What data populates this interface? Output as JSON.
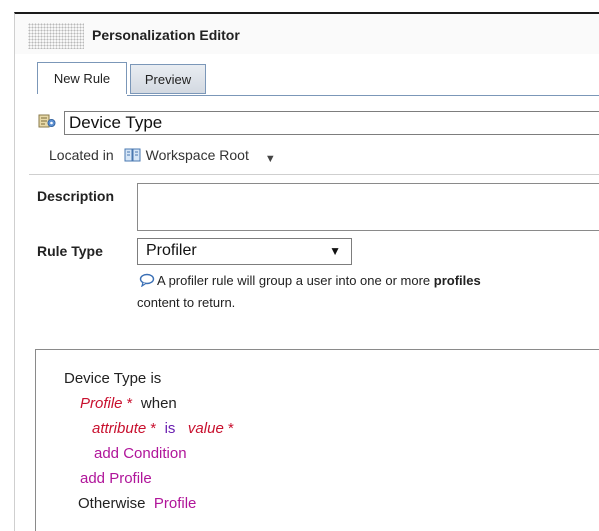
{
  "editor": {
    "title": "Personalization Editor"
  },
  "tabs": [
    {
      "label": "New Rule",
      "active": true
    },
    {
      "label": "Preview",
      "active": false
    }
  ],
  "rule": {
    "name": "Device Type",
    "located_in_label": "Located in",
    "location": "Workspace Root"
  },
  "form": {
    "description_label": "Description",
    "description_value": "",
    "rule_type_label": "Rule Type",
    "rule_type_value": "Profiler",
    "hint_prefix": "A profiler rule will group a user into one or more ",
    "hint_bold": "profiles",
    "hint_line2": "content to return."
  },
  "rule_body": {
    "subject": "Device Type",
    "is": "is",
    "profile": "Profile",
    "star": "*",
    "when": "when",
    "attribute": "attribute",
    "op_is": "is",
    "value": "value",
    "add_condition": "add Condition",
    "add_profile": "add Profile",
    "otherwise": "Otherwise",
    "otherwise_profile": "Profile"
  },
  "colors": {
    "required": "#c8102e",
    "link": "#b0159a",
    "operator": "#6a1fb0",
    "tab_border": "#7b97b8"
  },
  "icons": {
    "grip": "drag-grip-icon",
    "rule": "rule-icon",
    "location": "book-icon",
    "dropdown": "chevron-down-icon",
    "hint": "speech-bubble-icon"
  }
}
